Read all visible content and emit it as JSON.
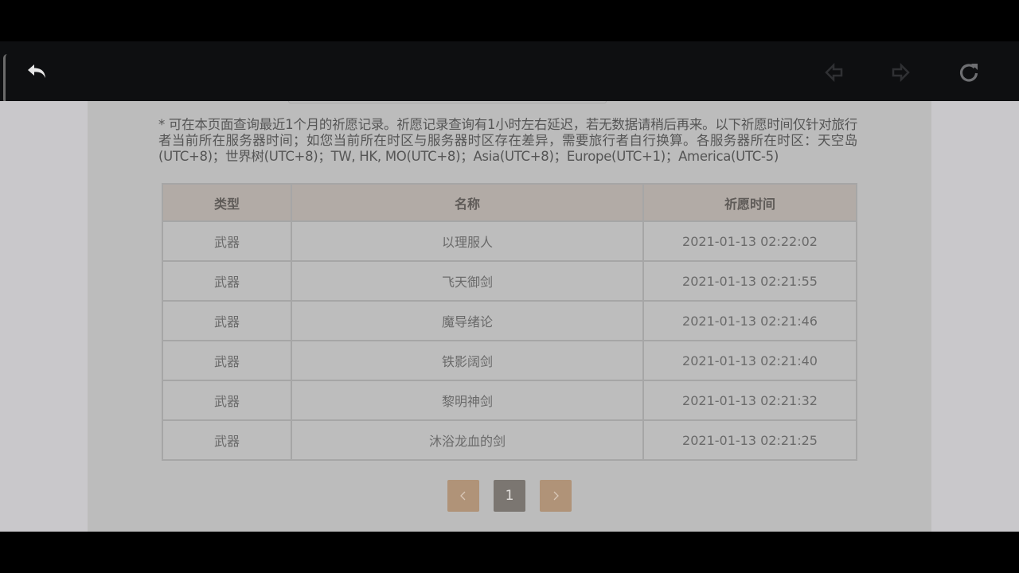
{
  "notice": "* 可在本页面查询最近1个月的祈愿记录。祈愿记录查询有1小时左右延迟，若无数据请稍后再来。以下祈愿时间仅针对旅行者当前所在服务器时间；如您当前所在时区与服务器时区存在差异，需要旅行者自行换算。各服务器所在时区：天空岛(UTC+8)；世界树(UTC+8)；TW, HK, MO(UTC+8)；Asia(UTC+8)；Europe(UTC+1)；America(UTC-5)",
  "table": {
    "headers": [
      "类型",
      "名称",
      "祈愿时间"
    ],
    "rows": [
      {
        "type": "武器",
        "name": "以理服人",
        "time": "2021-01-13 02:22:02"
      },
      {
        "type": "武器",
        "name": "飞天御剑",
        "time": "2021-01-13 02:21:55"
      },
      {
        "type": "武器",
        "name": "魔导绪论",
        "time": "2021-01-13 02:21:46"
      },
      {
        "type": "武器",
        "name": "铁影阔剑",
        "time": "2021-01-13 02:21:40"
      },
      {
        "type": "武器",
        "name": "黎明神剑",
        "time": "2021-01-13 02:21:32"
      },
      {
        "type": "武器",
        "name": "沐浴龙血的剑",
        "time": "2021-01-13 02:21:25"
      }
    ]
  },
  "pagination": {
    "current_page": "1",
    "prev_icon": "chevron-left-icon",
    "next_icon": "chevron-right-icon"
  },
  "toolbar": {
    "back_icon": "back-arrow-icon",
    "prev_icon": "nav-back-icon",
    "next_icon": "nav-forward-icon",
    "refresh_icon": "refresh-icon"
  },
  "colors": {
    "toolbar_bg": "#0e0f11",
    "page_bg": "#c9c8cb",
    "panel_bg": "#bcbcbc",
    "header_bg": "#b2aba6",
    "pager_arrow_bg": "#b09378",
    "pager_active_bg": "#7b7671"
  }
}
